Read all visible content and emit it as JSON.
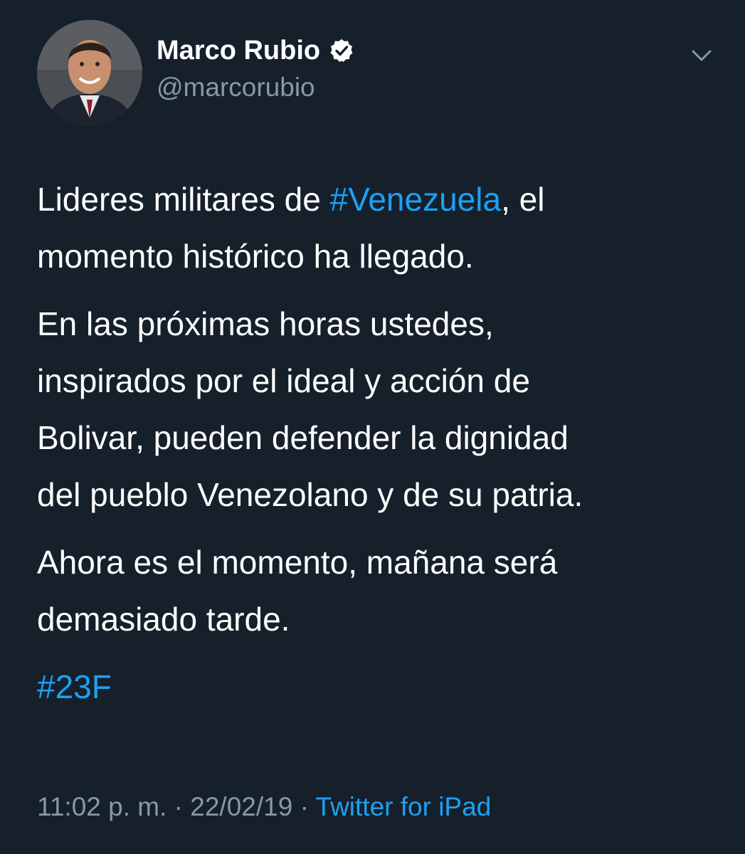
{
  "author": {
    "display_name": "Marco Rubio",
    "handle": "@marcorubio",
    "verified": true,
    "avatar_icon": "avatar-photo",
    "verified_icon": "verified-badge-icon"
  },
  "menu": {
    "icon": "chevron-down-icon"
  },
  "tweet": {
    "p1": {
      "l1_pre": "Lideres militares de ",
      "l1_hashtag": "#Venezuela",
      "l1_post": ", el",
      "l2": "momento histórico ha llegado."
    },
    "p2": {
      "l1": "En las próximas horas ustedes,",
      "l2": "inspirados por el ideal y acción de",
      "l3": "Bolivar, pueden defender la dignidad",
      "l4": "del pueblo Venezolano y de su patria."
    },
    "p3": {
      "l1": "Ahora es el momento, mañana será",
      "l2": "demasiado tarde."
    },
    "p4": {
      "hashtag": "#23F"
    }
  },
  "meta": {
    "time": "11:02 p. m.",
    "separator": " · ",
    "date": "22/02/19",
    "source": "Twitter for iPad"
  },
  "colors": {
    "background": "#15202b",
    "text": "#ffffff",
    "secondary": "#8899a6",
    "accent": "#1da1f2"
  }
}
